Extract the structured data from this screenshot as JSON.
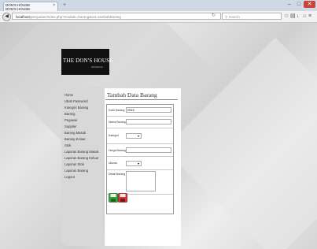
{
  "browser": {
    "tab_title_line1": "DON'S HOUSE",
    "tab_title_line2": "DON'S HOUSE",
    "tab_close": "×",
    "new_tab": "+",
    "url_host": "localhost",
    "url_path": "/penjualan/index.php?module=barang&act=tambahbarang",
    "search_placeholder": "Search"
  },
  "logo": {
    "name": "THE DON'S HOUSE",
    "sub": "RESIDENCE"
  },
  "menu": [
    "Home",
    "Ubah Password",
    "Kategori Barang",
    "Barang",
    "Pegawai",
    "Supplier",
    "Barang Masuk",
    "Barang Keluar",
    "Stok",
    "Laporan Barang Masuk",
    "Laporan Barang Keluar",
    "Laporan Stok",
    "Laporan Barang",
    "Logout"
  ],
  "page_title": "Tambah Data Barang",
  "form": {
    "kode_label": "Kode Barang",
    "kode_value": "KB18",
    "nama_label": "Nama Barang",
    "kategori_label": "Kategori",
    "harga_label": "Harga Barang",
    "ukuran_label": "Ukuran",
    "detail_label": "Detail Barang"
  },
  "icons": {
    "save": "save-icon",
    "reset": "reset-icon",
    "accent_green": "#3aa83a",
    "accent_red": "#d43a3a"
  }
}
